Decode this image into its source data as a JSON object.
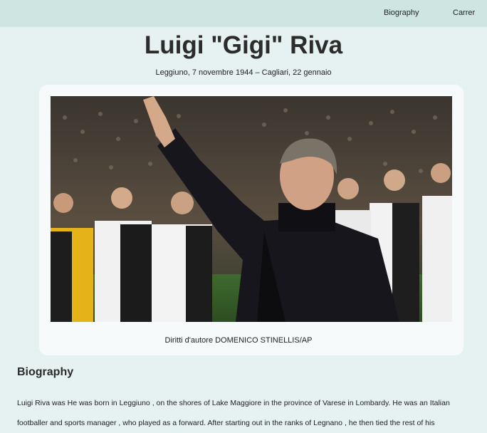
{
  "nav": {
    "biography": "Biography",
    "career": "Carrer"
  },
  "header": {
    "title": "Luigi \"Gigi\" Riva",
    "dates": "Leggiuno, 7 novembre 1944 – Cagliari, 22 gennaio"
  },
  "photo": {
    "caption": "Diritti d'autore DOMENICO STINELLIS/AP"
  },
  "biography": {
    "heading": "Biography",
    "text": "Luigi Riva was He was born in Leggiuno , on the shores of Lake Maggiore in the province of Varese in Lombardy. He was an Italian footballer and sports manager , who played as a forward. After starting out in the ranks of Legnano , he then tied the rest of his"
  },
  "colors": {
    "topbar": "#cfe5e1",
    "page_background": "#e6f2f1",
    "card_background": "#f6fafa"
  }
}
